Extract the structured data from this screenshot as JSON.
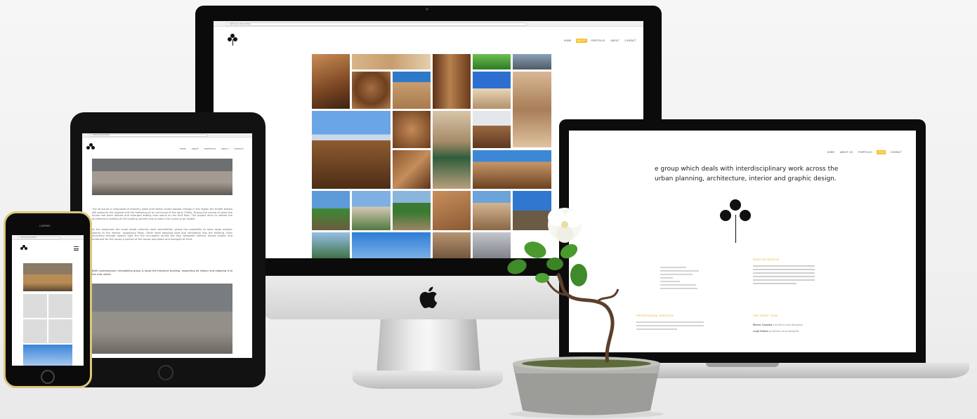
{
  "site": {
    "logo_name": "clover-logo",
    "nav": [
      "HOME",
      "ABOUT",
      "PORTFOLIO",
      "ABOUT",
      "CONTACT"
    ],
    "active_nav_color": "#f6c12c"
  },
  "imac": {
    "url": "catmacdo.it/portfolio",
    "gallery_tiles": 27
  },
  "laptop": {
    "nav": [
      "HOME",
      "ABOUT US",
      "PORTFOLIO",
      "TEAM",
      "CONTACT"
    ],
    "tagline_line1": "e group which deals with interdisciplinary work across the",
    "tagline_line2": "urban planning, architecture, interior and graphic design.",
    "section_what_we_believe": "WHAT WE BELIEVE",
    "section_professional_services": "PROFESSIONAL SERVICES",
    "section_our_team": "THE GREAT TEAM",
    "team_member_1": "Marco Caroleo",
    "team_member_1_role": "architect and designer",
    "team_member_2": "Luigi Solina",
    "team_member_2_role": "architect and designer"
  },
  "tablet": {
    "paragraph_1": "The structure is composed of masonry walls and timber vaults topped ceilings in the region the timber beams still preserve the original and the flattening of an old house of the early 1900s. During the course of years the house had been altered and enlarged adding new rooms on the first floor. The project aims to restore the architectural reading of the building volume and to return the house to be livable.",
    "paragraph_2": "At the basement the small street volumes were demolished, giving the possibility to open large outdoor spaces to the interior, organizing flows. Other steel stepping light and ventilation into the building. Floor according enough spaces light the the occupants across the day. Designed without excess plastic and ornament for the house a portion of the house was taken and enlarged at front.",
    "paragraph_3": "Both contemporary remodelling group & jacob the historical building, respecting its history and adapting it to the new needs."
  },
  "phone": {
    "carrier": "CARRIER"
  },
  "colors": {
    "accent": "#f6c12c",
    "orange_heading": "#f0a81c",
    "bezel": "#0b0b0b",
    "phone_gold": "#d9c87d"
  }
}
